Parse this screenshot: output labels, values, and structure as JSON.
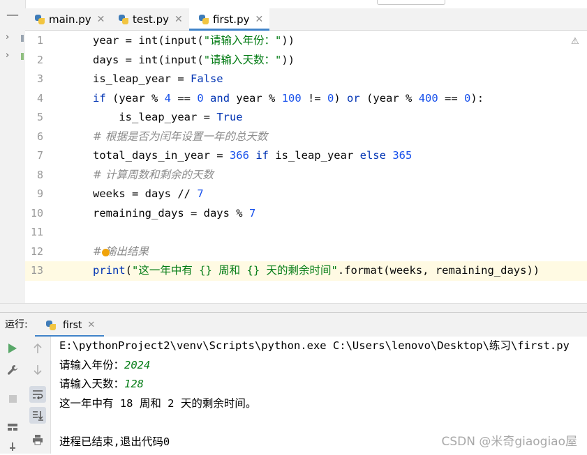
{
  "tabs": [
    {
      "name": "main.py",
      "active": false
    },
    {
      "name": "test.py",
      "active": false
    },
    {
      "name": "first.py",
      "active": true
    }
  ],
  "editor": {
    "lines": [
      {
        "n": "1",
        "parts": [
          [
            "",
            "year = "
          ],
          [
            "",
            "int"
          ],
          [
            "",
            "("
          ],
          [
            "",
            "input"
          ],
          [
            "",
            "("
          ],
          [
            "str",
            "\"请输入年份：\""
          ],
          [
            "",
            "))"
          ]
        ]
      },
      {
        "n": "2",
        "parts": [
          [
            "",
            "days = "
          ],
          [
            "",
            "int"
          ],
          [
            "",
            "("
          ],
          [
            "",
            "input"
          ],
          [
            "",
            "("
          ],
          [
            "str",
            "\"请输入天数：\""
          ],
          [
            "",
            "))"
          ]
        ]
      },
      {
        "n": "3",
        "parts": [
          [
            "",
            "is_leap_year = "
          ],
          [
            "kw",
            "False"
          ]
        ]
      },
      {
        "n": "4",
        "parts": [
          [
            "kw",
            "if"
          ],
          [
            "",
            " (year % "
          ],
          [
            "num",
            "4"
          ],
          [
            "",
            " == "
          ],
          [
            "num",
            "0"
          ],
          [
            "",
            " "
          ],
          [
            "kw",
            "and"
          ],
          [
            "",
            " year % "
          ],
          [
            "num",
            "100"
          ],
          [
            "",
            " != "
          ],
          [
            "num",
            "0"
          ],
          [
            "",
            ") "
          ],
          [
            "kw",
            "or"
          ],
          [
            "",
            " (year % "
          ],
          [
            "num",
            "400"
          ],
          [
            "",
            " == "
          ],
          [
            "num",
            "0"
          ],
          [
            "",
            "):"
          ]
        ]
      },
      {
        "n": "5",
        "parts": [
          [
            "",
            "    is_leap_year = "
          ],
          [
            "kw",
            "True"
          ]
        ]
      },
      {
        "n": "6",
        "parts": [
          [
            "cmt",
            "# 根据是否为闰年设置一年的总天数"
          ]
        ]
      },
      {
        "n": "7",
        "parts": [
          [
            "",
            "total_days_in_year = "
          ],
          [
            "num",
            "366"
          ],
          [
            "",
            " "
          ],
          [
            "kw",
            "if"
          ],
          [
            "",
            " is_leap_year "
          ],
          [
            "kw",
            "else"
          ],
          [
            "",
            " "
          ],
          [
            "num",
            "365"
          ]
        ]
      },
      {
        "n": "8",
        "parts": [
          [
            "cmt",
            "# 计算周数和剩余的天数"
          ]
        ]
      },
      {
        "n": "9",
        "parts": [
          [
            "",
            "weeks = days // "
          ],
          [
            "num",
            "7"
          ]
        ]
      },
      {
        "n": "10",
        "parts": [
          [
            "",
            "remaining_days = days % "
          ],
          [
            "num",
            "7"
          ]
        ]
      },
      {
        "n": "11",
        "parts": []
      },
      {
        "n": "12",
        "parts": [
          [
            "cmt",
            "# 输出结果"
          ]
        ]
      },
      {
        "n": "13",
        "parts": [
          [
            "kw",
            "print"
          ],
          [
            "",
            "("
          ],
          [
            "str",
            "\"这一年中有 {} 周和 {} 天的剩余时间\""
          ],
          [
            "",
            ".format(weeks, remaining_days))"
          ]
        ]
      }
    ],
    "current_line": "13"
  },
  "run": {
    "label": "运行:",
    "tab": "first"
  },
  "console": {
    "command": "E:\\pythonProject2\\venv\\Scripts\\python.exe C:\\Users\\lenovo\\Desktop\\练习\\first.py",
    "prompt_year": "请输入年份：",
    "input_year": "2024",
    "prompt_days": "请输入天数：",
    "input_days": "128",
    "result": "这一年中有 18 周和 2 天的剩余时间。",
    "exit": "进程已结束,退出代码0"
  },
  "watermark": "CSDN @米奇giaogiao屋",
  "colors": {
    "keyword": "#0033b3",
    "number": "#1750eb",
    "string": "#067d17",
    "comment": "#8c8c8c",
    "accent": "#4083c9",
    "current_line": "#fffae3"
  }
}
